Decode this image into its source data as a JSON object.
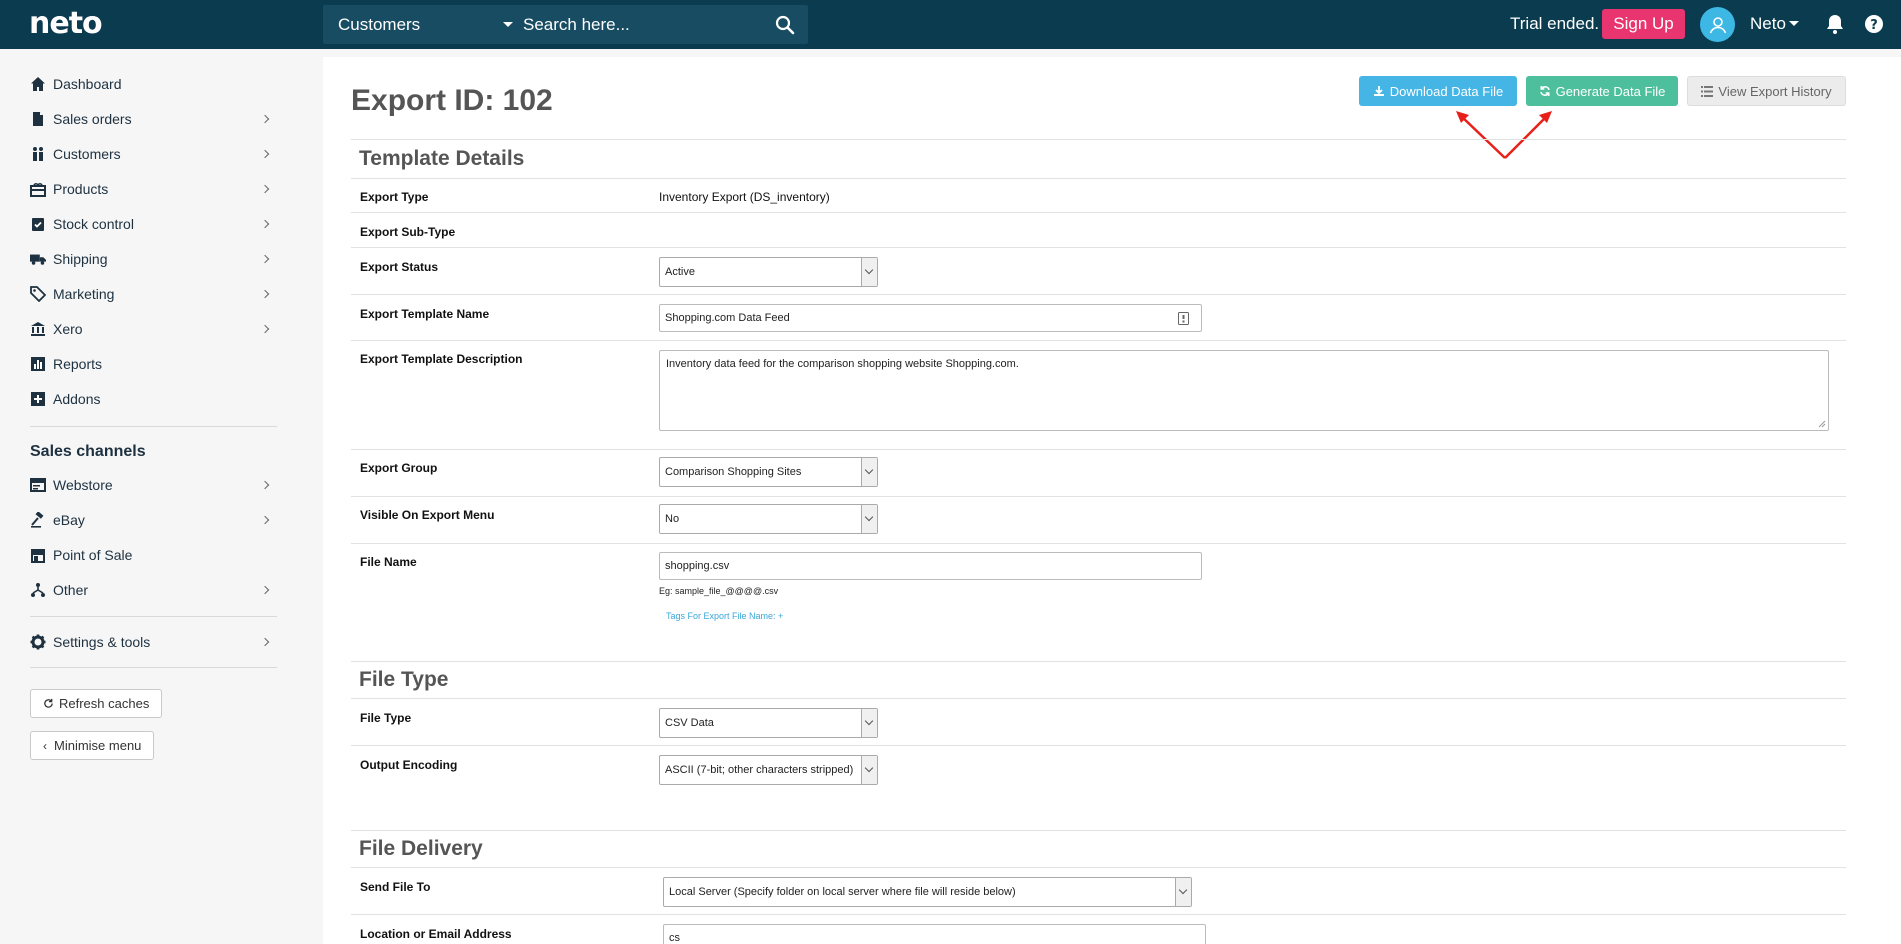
{
  "app": {
    "logo": "neto"
  },
  "topbar": {
    "search_scope": "Customers",
    "search_placeholder": "Search here...",
    "trial_text": "Trial ended.",
    "signup_label": "Sign Up",
    "user_name": "Neto"
  },
  "sidebar": {
    "items": [
      {
        "label": "Dashboard",
        "icon": "home-icon"
      },
      {
        "label": "Sales orders",
        "icon": "file-icon"
      },
      {
        "label": "Customers",
        "icon": "users-icon"
      },
      {
        "label": "Products",
        "icon": "gift-icon"
      },
      {
        "label": "Stock control",
        "icon": "clipboard-check-icon"
      },
      {
        "label": "Shipping",
        "icon": "truck-icon"
      },
      {
        "label": "Marketing",
        "icon": "tags-icon"
      },
      {
        "label": "Xero",
        "icon": "bank-icon"
      },
      {
        "label": "Reports",
        "icon": "bar-chart-icon"
      },
      {
        "label": "Addons",
        "icon": "plus-square-icon"
      }
    ],
    "channels_heading": "Sales channels",
    "channels": [
      {
        "label": "Webstore",
        "icon": "browser-icon"
      },
      {
        "label": "eBay",
        "icon": "gavel-icon"
      },
      {
        "label": "Point of Sale",
        "icon": "store-icon"
      },
      {
        "label": "Other",
        "icon": "sitemap-icon"
      }
    ],
    "settings_label": "Settings & tools",
    "refresh_label": "Refresh caches",
    "minimise_label": "Minimise menu"
  },
  "page": {
    "title": "Export ID: 102",
    "download_label": "Download Data File",
    "generate_label": "Generate Data File",
    "history_label": "View Export History"
  },
  "template_details": {
    "heading": "Template Details",
    "export_type_label": "Export Type",
    "export_type_value": "Inventory Export (DS_inventory)",
    "export_subtype_label": "Export Sub-Type",
    "export_status_label": "Export Status",
    "export_status_value": "Active",
    "template_name_label": "Export Template Name",
    "template_name_value": "Shopping.com Data Feed",
    "template_desc_label": "Export Template Description",
    "template_desc_value": "Inventory data feed for the comparison shopping website Shopping.com.",
    "export_group_label": "Export Group",
    "export_group_value": "Comparison Shopping Sites",
    "visible_label": "Visible On Export Menu",
    "visible_value": "No",
    "file_name_label": "File Name",
    "file_name_value": "shopping.csv",
    "file_name_hint": "Eg: sample_file_@@@@.csv",
    "tags_link": "Tags For Export File Name: +"
  },
  "file_type": {
    "heading": "File Type",
    "file_type_label": "File Type",
    "file_type_value": "CSV Data",
    "encoding_label": "Output Encoding",
    "encoding_value": "ASCII (7-bit; other characters stripped)"
  },
  "file_delivery": {
    "heading": "File Delivery",
    "send_to_label": "Send File To",
    "send_to_value": "Local Server (Specify folder on local server where file will reside below)",
    "location_label": "Location or Email Address",
    "location_value": "cs"
  },
  "colors": {
    "topbar": "#0b3b4f",
    "signup": "#e8356f",
    "download": "#45b5e6",
    "generate": "#4ebf9c",
    "annotation": "#e8201a"
  }
}
